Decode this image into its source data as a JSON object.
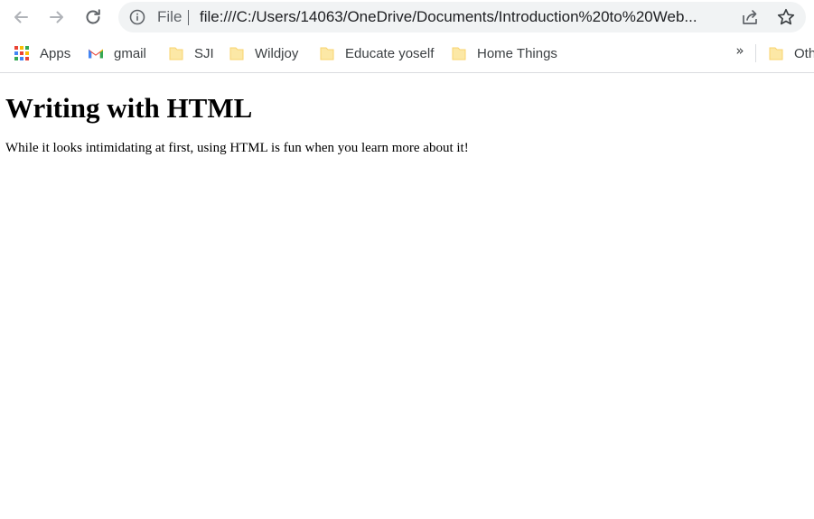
{
  "browser": {
    "address_bar": {
      "scheme_label": "File",
      "url": "file:///C:/Users/14063/OneDrive/Documents/Introduction%20to%20Web..."
    },
    "bookmarks": [
      {
        "label": "Apps",
        "icon": "apps-grid-icon"
      },
      {
        "label": "gmail",
        "icon": "gmail-icon"
      },
      {
        "label": "SJI",
        "icon": "folder-icon"
      },
      {
        "label": "Wildjoy",
        "icon": "folder-icon"
      },
      {
        "label": "Educate yoself",
        "icon": "folder-icon"
      },
      {
        "label": "Home Things",
        "icon": "folder-icon"
      },
      {
        "label": "Oth",
        "icon": "folder-icon"
      }
    ],
    "overflow_label": "»",
    "colors": {
      "folder": "#fce8a6",
      "folder_edge": "#f9d36e",
      "icon_gray": "#5f6368",
      "omnibox_bg": "#f1f3f4"
    }
  },
  "page": {
    "heading": "Writing with HTML",
    "paragraph": "While it looks intimidating at first, using HTML is fun when you learn more about it!"
  }
}
